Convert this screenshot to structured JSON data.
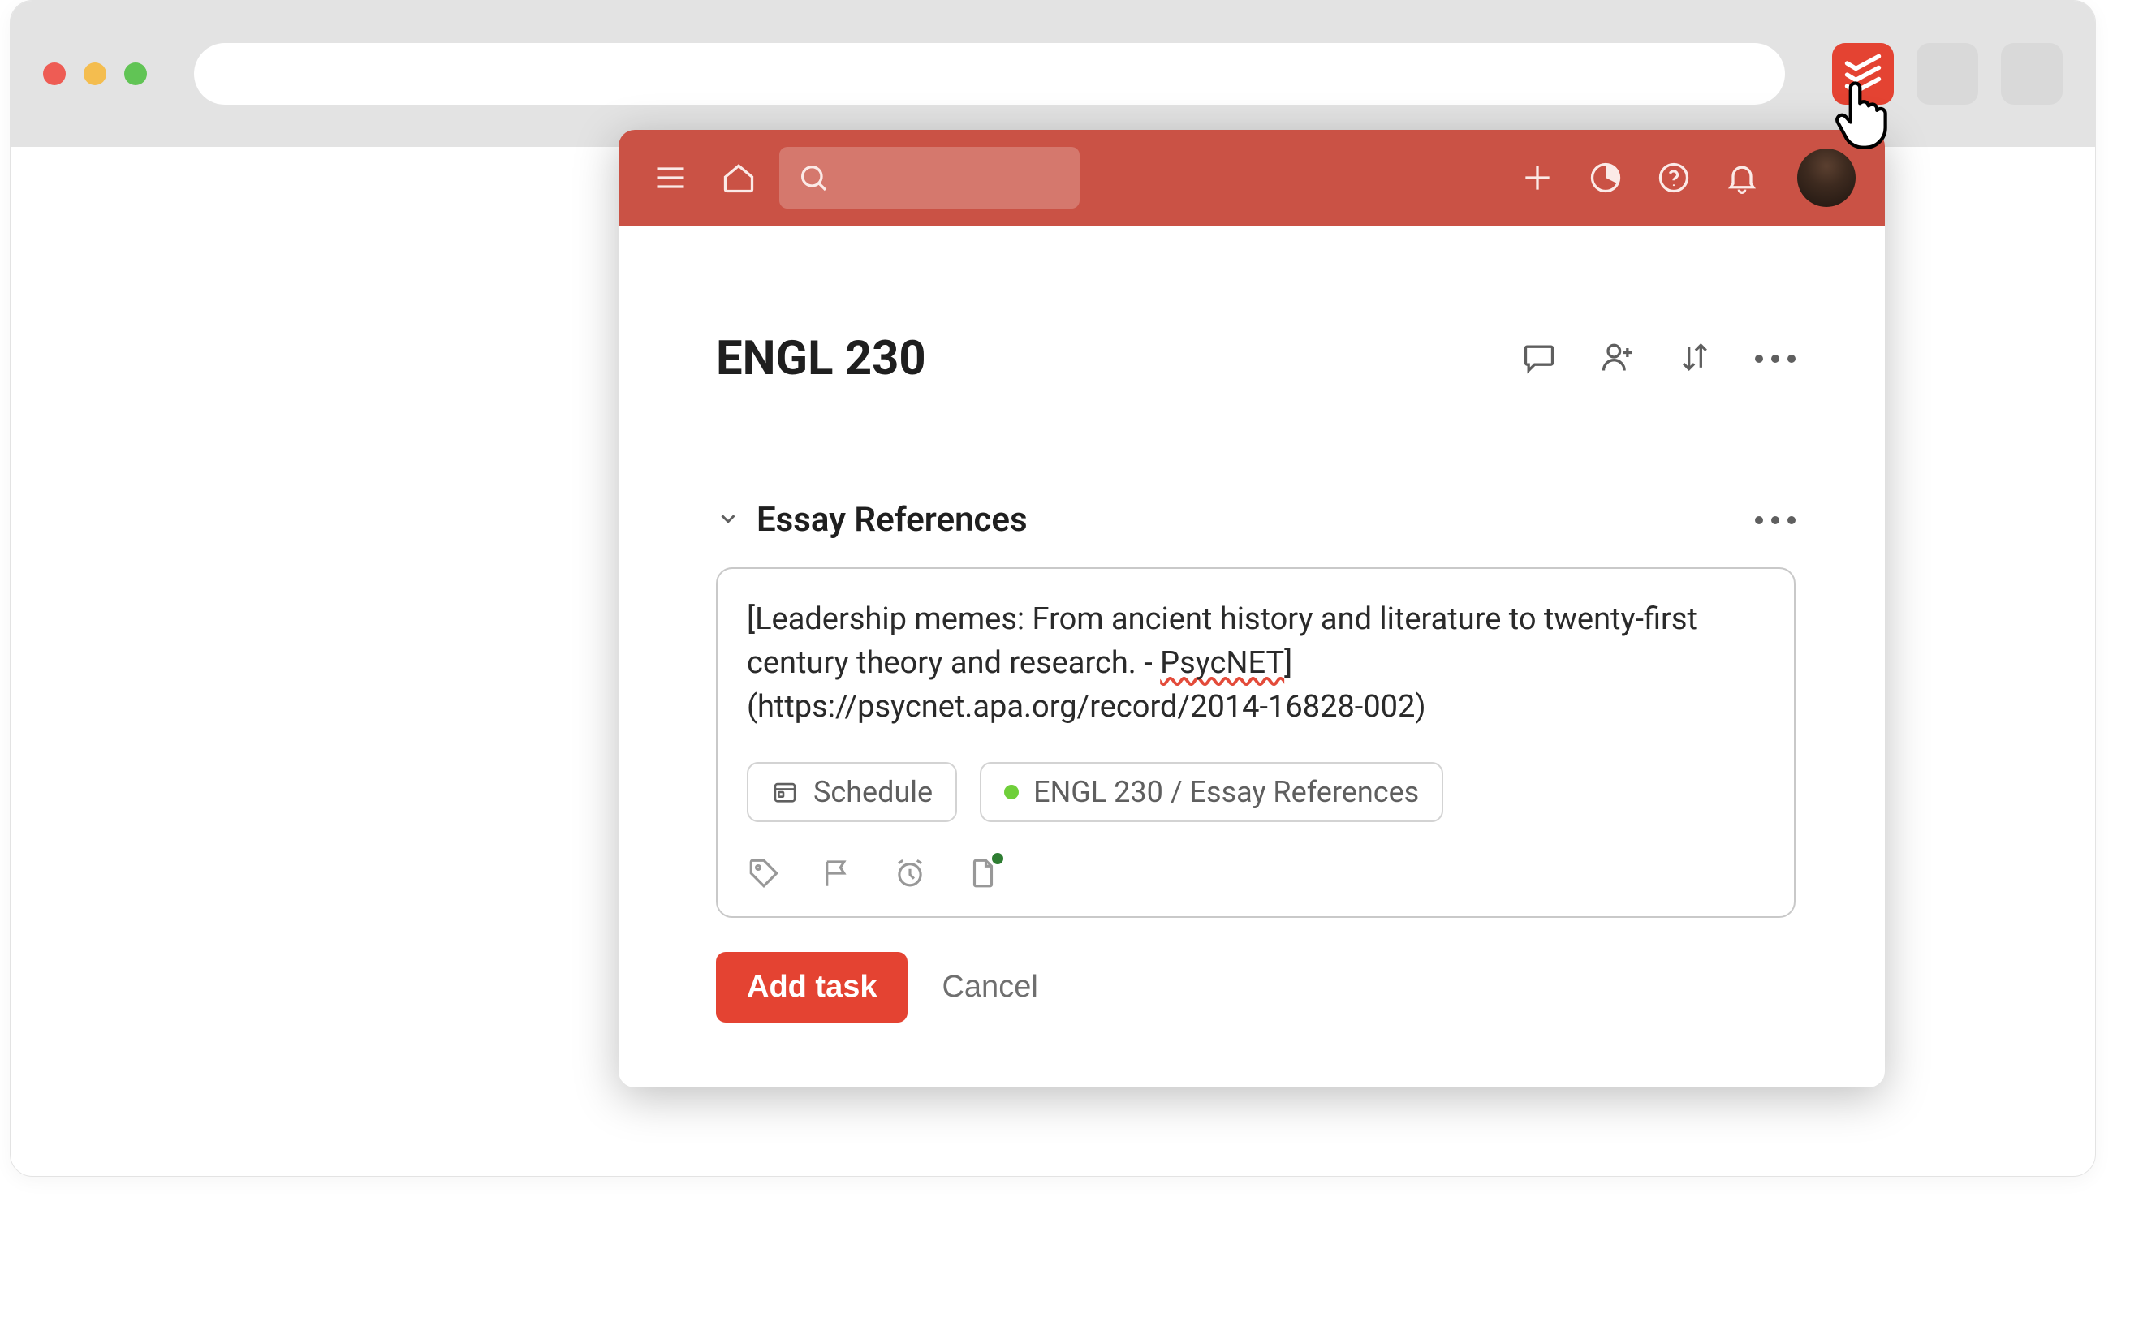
{
  "popup": {
    "project_title": "ENGL 230",
    "section_title": "Essay References",
    "task_text_full": "[Leadership memes: From ancient history and literature to twenty-first century theory and research. - PsycNET](https://psycnet.apa.org/record/2014-16828-002)",
    "task_text_pre": "[Leadership memes: From ancient history and literature to twenty-first century theory and research. - ",
    "task_text_spell": "PsycNET",
    "task_text_post": "](https://psycnet.apa.org/record/2014-16828-002)",
    "schedule_label": "Schedule",
    "project_chip_label": "ENGL 230 / Essay References",
    "add_task_label": "Add task",
    "cancel_label": "Cancel"
  }
}
